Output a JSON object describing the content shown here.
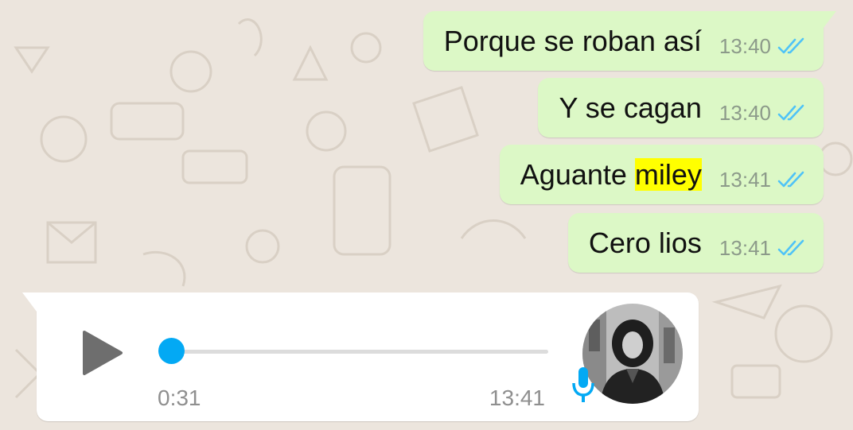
{
  "messages": [
    {
      "text_before": "Porque se roban así",
      "highlight": "",
      "time": "13:40"
    },
    {
      "text_before": "Y se cagan",
      "highlight": "",
      "time": "13:40"
    },
    {
      "text_before": "Aguante ",
      "highlight": "miley",
      "time": "13:41"
    },
    {
      "text_before": "Cero lios",
      "highlight": "",
      "time": "13:41"
    }
  ],
  "voice_message": {
    "duration": "0:31",
    "time": "13:41"
  },
  "colors": {
    "outgoing_bubble": "#dcf8c6",
    "read_ticks": "#4fc3f7",
    "highlight": "#ffff00",
    "progress_knob": "#03a9f4"
  },
  "icons": [
    "double-check-read-icon",
    "play-icon",
    "microphone-icon"
  ]
}
